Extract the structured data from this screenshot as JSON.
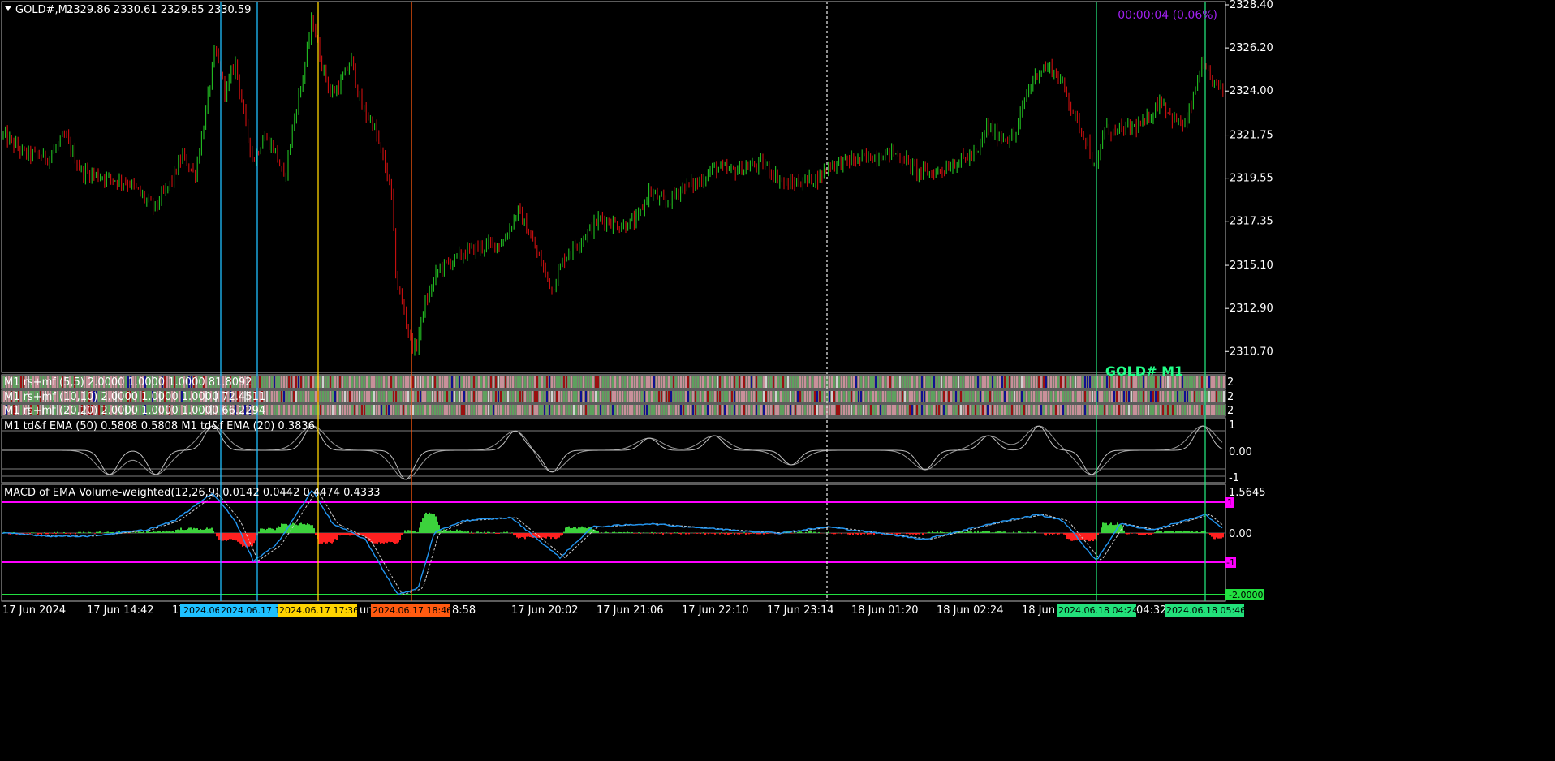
{
  "chart_header": {
    "symbol": "GOLD#,M1",
    "ohlc": "2329.86 2330.61 2329.85 2330.59"
  },
  "timer": "00:00:04 (0.06%)",
  "watermark": "GOLD# M1",
  "colors": {
    "background": "#000000",
    "bull_candle": "#22c022",
    "bear_candle": "#cc1010",
    "cyan_marker": "#1ec0ff",
    "yellow_marker": "#ffd400",
    "orange_marker": "#ff5a10",
    "green_marker": "#22e07a",
    "magenta_level": "#ff00ff",
    "macd_line": "#2196f3",
    "timer": "#a020f0",
    "watermark": "#22ff88"
  },
  "price_axis": [
    "2328.40",
    "2326.20",
    "2324.00",
    "2321.75",
    "2319.55",
    "2317.35",
    "2315.10",
    "2312.90",
    "2310.70"
  ],
  "time_axis": [
    "17 Jun 2024",
    "17 Jun 14:42",
    "17",
    "17 Jun 20:02",
    "17 Jun 21:06",
    "17 Jun 22:10",
    "17 Jun 23:14",
    "18 Jun 01:20",
    "18 Jun 02:24",
    "18 Jun",
    "04:32"
  ],
  "time_markers": [
    {
      "label": "2024.06",
      "color": "#1ec0ff"
    },
    {
      "label": "2024.06.17 1",
      "color": "#1ec0ff"
    },
    {
      "label": "2024.06.17 17:36",
      "color": "#ffd400"
    },
    {
      "label": "2024.06.17 18:46",
      "color": "#ff5a10"
    },
    {
      "label": "2024.06.18 04:24",
      "color": "#22e07a"
    },
    {
      "label": "2024.06.18 05:46",
      "color": "#22e07a"
    }
  ],
  "time_axis_fragments": {
    "after_orange_left": "un",
    "after_orange_right": "8:58"
  },
  "rs_panels": [
    {
      "label": "M1 rs+mf (5,5) 2.0000 1.0000 1.0000 81.8092",
      "right": "2"
    },
    {
      "label": "M1 rs+mf (10,10) 2.0000 1.0000 1.0000 72.4511",
      "right": "2"
    },
    {
      "label": "M1 rs+mf (20,20) 2.0000 1.0000 1.0000 66.2294",
      "right": "2"
    }
  ],
  "td_panel": {
    "label": "M1 td&f EMA (50) 0.5808 0.5808  M1 td&f EMA (20) 0.3836",
    "axis": [
      "1",
      "0.00",
      "-1"
    ]
  },
  "macd_panel": {
    "label": "MACD of EMA Volume-weighted(12,26,9) 0.0142 0.0442 0.4474 0.4333",
    "axis": [
      "1.5645",
      "0.00"
    ],
    "level_up": "1",
    "level_down": "-1",
    "level_low": "-2.0000"
  },
  "chart_data": {
    "type": "candlestick",
    "symbol": "GOLD#",
    "timeframe": "M1",
    "ylim": [
      2309.8,
      2328.4
    ],
    "anchors": [
      [
        0,
        2321.9
      ],
      [
        30,
        2320.8
      ],
      [
        60,
        2320.6
      ],
      [
        80,
        2321.7
      ],
      [
        100,
        2319.9
      ],
      [
        130,
        2319.6
      ],
      [
        160,
        2319.3
      ],
      [
        190,
        2318.0
      ],
      [
        210,
        2319.3
      ],
      [
        225,
        2320.7
      ],
      [
        240,
        2319.7
      ],
      [
        252,
        2322.5
      ],
      [
        265,
        2326.1
      ],
      [
        278,
        2323.9
      ],
      [
        290,
        2325.5
      ],
      [
        302,
        2322.4
      ],
      [
        312,
        2320.4
      ],
      [
        325,
        2321.7
      ],
      [
        340,
        2320.9
      ],
      [
        350,
        2319.4
      ],
      [
        362,
        2322.5
      ],
      [
        374,
        2324.9
      ],
      [
        385,
        2327.8
      ],
      [
        393,
        2325.9
      ],
      [
        408,
        2323.8
      ],
      [
        420,
        2324.4
      ],
      [
        433,
        2325.6
      ],
      [
        445,
        2323.2
      ],
      [
        460,
        2322.3
      ],
      [
        472,
        2320.5
      ],
      [
        482,
        2318.9
      ],
      [
        488,
        2314.4
      ],
      [
        497,
        2312.9
      ],
      [
        505,
        2311.4
      ],
      [
        512,
        2310.7
      ],
      [
        522,
        2312.9
      ],
      [
        540,
        2314.9
      ],
      [
        560,
        2315.4
      ],
      [
        580,
        2315.9
      ],
      [
        600,
        2316.1
      ],
      [
        620,
        2316.3
      ],
      [
        638,
        2317.9
      ],
      [
        650,
        2316.9
      ],
      [
        665,
        2315.4
      ],
      [
        680,
        2313.9
      ],
      [
        695,
        2315.5
      ],
      [
        715,
        2316.4
      ],
      [
        740,
        2317.5
      ],
      [
        765,
        2317.1
      ],
      [
        785,
        2317.4
      ],
      [
        800,
        2318.9
      ],
      [
        820,
        2318.2
      ],
      [
        840,
        2319.1
      ],
      [
        860,
        2319.3
      ],
      [
        880,
        2320.1
      ],
      [
        900,
        2319.9
      ],
      [
        920,
        2320.1
      ],
      [
        940,
        2320.3
      ],
      [
        955,
        2319.7
      ],
      [
        970,
        2319.2
      ],
      [
        990,
        2319.4
      ],
      [
        1010,
        2319.6
      ],
      [
        1020,
        2320.2
      ],
      [
        1040,
        2320.4
      ],
      [
        1060,
        2320.5
      ],
      [
        1080,
        2320.7
      ],
      [
        1100,
        2320.9
      ],
      [
        1115,
        2320.5
      ],
      [
        1130,
        2319.9
      ],
      [
        1150,
        2319.8
      ],
      [
        1170,
        2320.2
      ],
      [
        1190,
        2320.6
      ],
      [
        1205,
        2320.8
      ],
      [
        1215,
        2322.2
      ],
      [
        1230,
        2321.7
      ],
      [
        1250,
        2321.6
      ],
      [
        1265,
        2323.9
      ],
      [
        1280,
        2325.1
      ],
      [
        1295,
        2325.2
      ],
      [
        1310,
        2324.3
      ],
      [
        1325,
        2322.6
      ],
      [
        1340,
        2321.4
      ],
      [
        1350,
        2319.7
      ],
      [
        1360,
        2322.1
      ],
      [
        1375,
        2321.9
      ],
      [
        1390,
        2322.1
      ],
      [
        1410,
        2322.3
      ],
      [
        1430,
        2323.6
      ],
      [
        1445,
        2322.6
      ],
      [
        1460,
        2322.2
      ],
      [
        1470,
        2323.6
      ],
      [
        1480,
        2325.3
      ],
      [
        1490,
        2324.7
      ],
      [
        1505,
        2324.1
      ]
    ]
  }
}
